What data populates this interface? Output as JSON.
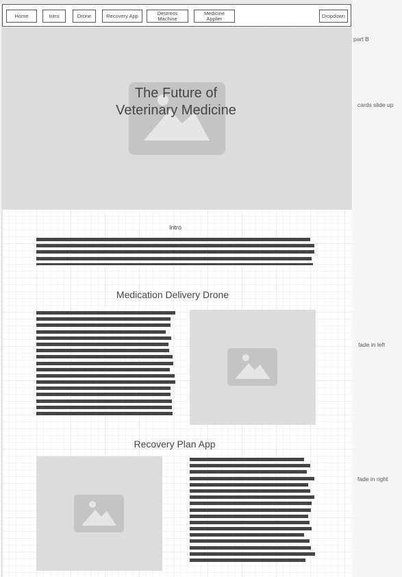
{
  "nav": {
    "items": [
      {
        "id": "home",
        "label": "Home"
      },
      {
        "id": "intro",
        "label": "Intro"
      },
      {
        "id": "drone",
        "label": "Drone"
      },
      {
        "id": "recovery",
        "label": "Recovery App"
      },
      {
        "id": "destress",
        "label_line1": "Destress",
        "label_line2": "Machine"
      },
      {
        "id": "medicine",
        "label_line1": "Medicine",
        "label_line2": "Applier"
      },
      {
        "id": "dropdown",
        "label": "Dropdown"
      }
    ]
  },
  "hero": {
    "title_line1": "The Future of",
    "title_line2": "Veterinary Medicine",
    "image_icon": "image-placeholder-icon"
  },
  "intro": {
    "heading": "Intro"
  },
  "drone": {
    "heading": "Medication Delivery Drone",
    "image_icon": "image-placeholder-icon"
  },
  "recovery": {
    "heading": "Recovery Plan App",
    "image_icon": "image-placeholder-icon"
  },
  "annotations": {
    "part": "part B",
    "hero_note": "cards slide up",
    "drone_note": "fade in left",
    "recovery_note": "fade in right"
  },
  "colors": {
    "placeholder_bg": "#dcdcdc",
    "placeholder_icon": "#c4c4c4",
    "text_bar": "#444444"
  }
}
